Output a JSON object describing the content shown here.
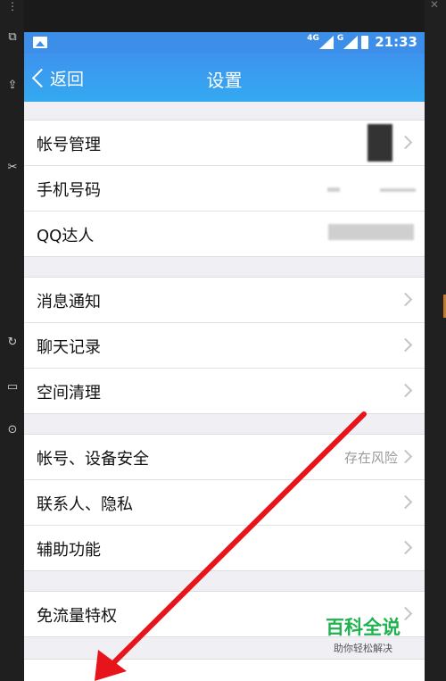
{
  "status_bar": {
    "network_label": "4G",
    "network_label_2": "G",
    "time": "21:33",
    "image_icon": "image-icon",
    "signal_icon": "signal-icon",
    "battery_icon": "battery-icon"
  },
  "navbar": {
    "back_label": "返回",
    "title": "设置"
  },
  "groups": [
    [
      {
        "label": "帐号管理",
        "value": "",
        "chevron": true
      },
      {
        "label": "手机号码",
        "value": "",
        "chevron": false
      },
      {
        "label": "QQ达人",
        "value": "",
        "chevron": false
      }
    ],
    [
      {
        "label": "消息通知",
        "value": "",
        "chevron": true
      },
      {
        "label": "聊天记录",
        "value": "",
        "chevron": true
      },
      {
        "label": "空间清理",
        "value": "",
        "chevron": true
      }
    ],
    [
      {
        "label": "帐号、设备安全",
        "value": "存在风险",
        "chevron": true
      },
      {
        "label": "联系人、隐私",
        "value": "",
        "chevron": true
      },
      {
        "label": "辅助功能",
        "value": "",
        "chevron": true
      }
    ],
    [
      {
        "label": "免流量特权",
        "value": "",
        "chevron": true
      }
    ]
  ],
  "watermark": {
    "main": "百科全说",
    "sub": "助你轻松解决"
  },
  "annotation_color": "#e8141b",
  "accent_color": "#3d8ee9"
}
